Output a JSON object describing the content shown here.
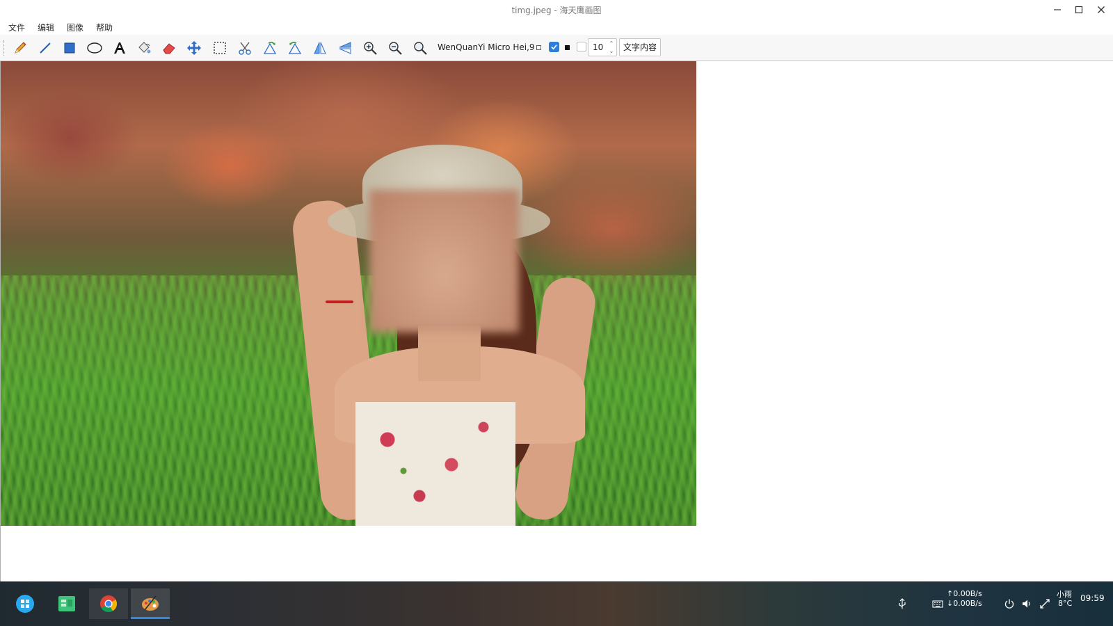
{
  "window": {
    "title": "timg.jpeg - 海天鹰画图",
    "controls": [
      "minimize",
      "maximize",
      "close"
    ]
  },
  "menu": {
    "items": [
      "文件",
      "编辑",
      "图像",
      "帮助"
    ]
  },
  "toolbar": {
    "tools": [
      "pencil-icon",
      "line-icon",
      "rectangle-icon",
      "ellipse-icon",
      "text-icon",
      "fill-bucket-icon",
      "eraser-icon",
      "move-icon",
      "select-rectangle-icon",
      "cut-icon",
      "rotate-left-icon",
      "rotate-right-icon",
      "flip-horizontal-icon",
      "flip-vertical-icon",
      "zoom-in-icon",
      "zoom-out-icon",
      "zoom-original-icon"
    ],
    "font": "WenQuanYi Micro Hei,9",
    "stroke_checked": true,
    "fill_checked": false,
    "size_value": "10",
    "text_button": "文字内容"
  },
  "canvas": {
    "image_file": "timg.jpeg"
  },
  "taskbar": {
    "apps": [
      "launcher-icon",
      "file-manager-icon",
      "chrome-icon",
      "paint-icon"
    ],
    "active_app": "paint-icon",
    "net_up": "0.00B/s",
    "net_down": "0.00B/s",
    "weather": "小雨",
    "temperature": "8°C",
    "clock": "09:59"
  },
  "colors": {
    "accent": "#2d7ed8",
    "taskbar": "#1f2a30"
  }
}
